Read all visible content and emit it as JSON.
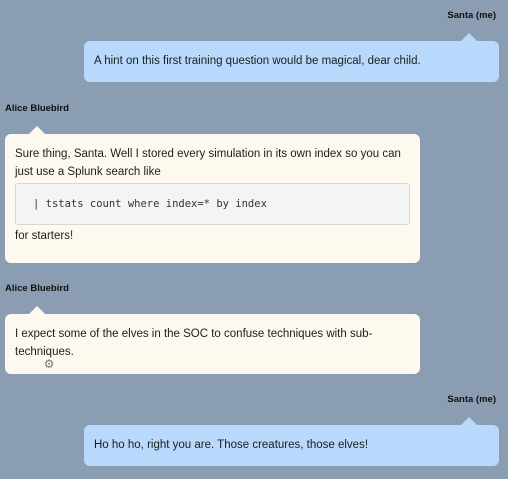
{
  "messages": [
    {
      "sender": "Santa (me)",
      "text": "A hint on this first training question would be magical, dear child."
    },
    {
      "sender": "Alice Bluebird",
      "text_before": "Sure thing, Santa. Well I stored every simulation in its own index so you can just use a Splunk search like",
      "code": "| tstats count where index=* by index",
      "text_after": "for starters!"
    },
    {
      "sender": "Alice Bluebird",
      "text": "I expect some of the elves in the SOC to confuse techniques with sub-techniques."
    },
    {
      "sender": "Santa (me)",
      "text": "Ho ho ho, right you are. Those creatures, those elves!"
    }
  ],
  "cursor": {
    "icon": "gear-cursor-icon"
  }
}
